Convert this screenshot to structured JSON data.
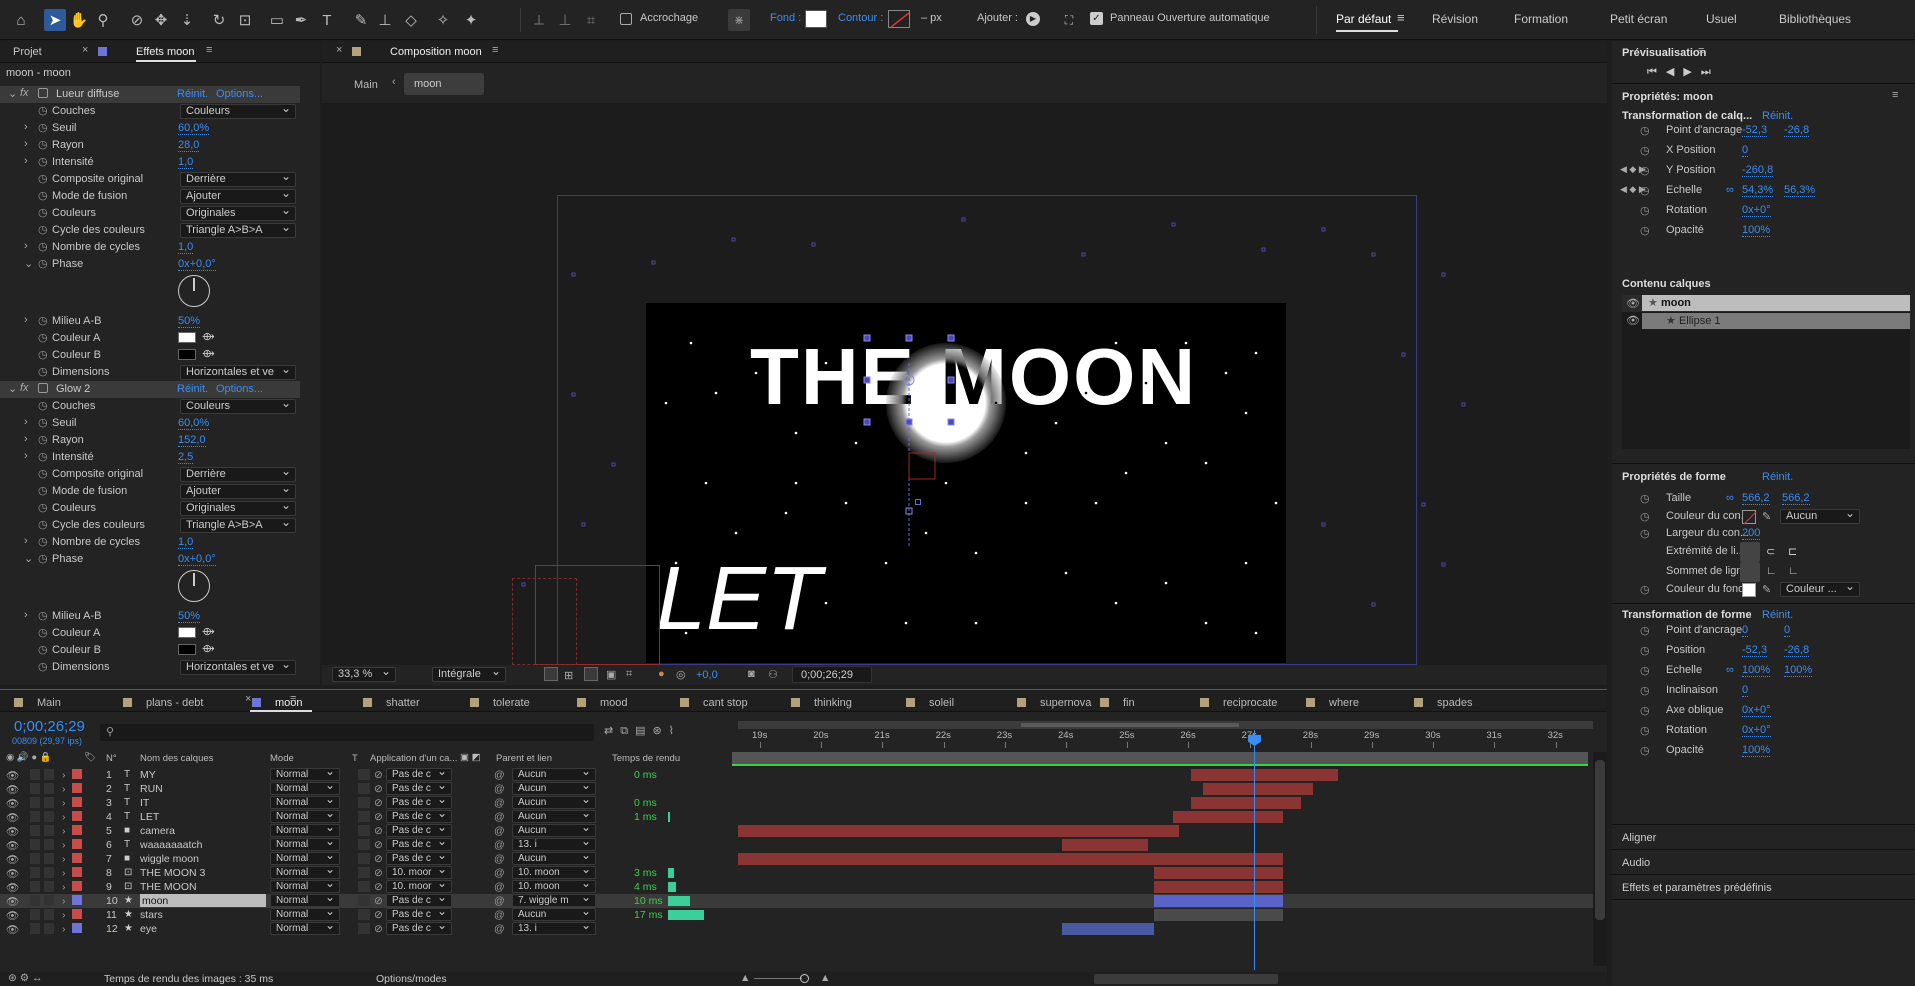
{
  "toolbar": {
    "snap_label": "Accrochage",
    "fill_label": "Fond :",
    "stroke_label": "Contour :",
    "px_label": "– px",
    "add_label": "Ajouter :",
    "auto_open_label": "Panneau Ouverture automatique"
  },
  "workspaces": [
    "Par défaut",
    "Révision",
    "Formation",
    "Petit écran",
    "Usuel",
    "Bibliothèques"
  ],
  "left_panel": {
    "tab_project": "Projet",
    "tab_effects": "Effets moon",
    "breadcrumb": "moon - moon",
    "effects": [
      {
        "name": "Lueur diffuse",
        "reset": "Réinit.",
        "options": "Options...",
        "props": [
          {
            "label": "Couches",
            "dd": "Couleurs"
          },
          {
            "label": "Seuil",
            "val": "60,0%"
          },
          {
            "label": "Rayon",
            "val": "28,0"
          },
          {
            "label": "Intensité",
            "val": "1,0"
          },
          {
            "label": "Composite original",
            "dd": "Derrière"
          },
          {
            "label": "Mode de fusion",
            "dd": "Ajouter"
          },
          {
            "label": "Couleurs",
            "dd": "Originales"
          },
          {
            "label": "Cycle des couleurs",
            "dd": "Triangle A>B>A"
          },
          {
            "label": "Nombre de cycles",
            "val": "1,0"
          },
          {
            "label": "Phase",
            "val": "0x+0,0°"
          },
          {
            "label": "Milieu A-B",
            "val": "50%"
          },
          {
            "label": "Couleur A"
          },
          {
            "label": "Couleur B"
          },
          {
            "label": "Dimensions",
            "dd": "Horizontales et ve"
          }
        ]
      },
      {
        "name": "Glow 2",
        "reset": "Réinit.",
        "options": "Options...",
        "props": [
          {
            "label": "Couches",
            "dd": "Couleurs"
          },
          {
            "label": "Seuil",
            "val": "60,0%"
          },
          {
            "label": "Rayon",
            "val": "152,0"
          },
          {
            "label": "Intensité",
            "val": "2,5"
          },
          {
            "label": "Composite original",
            "dd": "Derrière"
          },
          {
            "label": "Mode de fusion",
            "dd": "Ajouter"
          },
          {
            "label": "Couleurs",
            "dd": "Originales"
          },
          {
            "label": "Cycle des couleurs",
            "dd": "Triangle A>B>A"
          },
          {
            "label": "Nombre de cycles",
            "val": "1,0"
          },
          {
            "label": "Phase",
            "val": "0x+0,0°"
          },
          {
            "label": "Milieu A-B",
            "val": "50%"
          },
          {
            "label": "Couleur A"
          },
          {
            "label": "Couleur B"
          },
          {
            "label": "Dimensions",
            "dd": "Horizontales et ve"
          }
        ]
      }
    ]
  },
  "comp": {
    "tab": "Composition moon",
    "crumb_main": "Main",
    "crumb_moon": "moon",
    "title_text": "THE MOON",
    "let_text": "LET",
    "zoom": "33,3 %",
    "quality": "Intégrale",
    "exposure": "+0,0",
    "timecode": "0;00;26;29"
  },
  "timeline": {
    "tabs": [
      "Main",
      "plans - debt",
      "moon",
      "shatter",
      "tolerate",
      "mood",
      "cant stop",
      "thinking",
      "soleil",
      "supernova",
      "fin",
      "reciprocate",
      "where",
      "spades"
    ],
    "timecode": "0;00;26;29",
    "fps": "00809 (29,97 ips)",
    "headers": {
      "num": "N°",
      "name": "Nom des calques",
      "mode": "Mode",
      "t": "T",
      "app": "Application d'un ca...",
      "parent": "Parent et lien",
      "render": "Temps de rendu"
    },
    "ruler": [
      "19s",
      "20s",
      "21s",
      "22s",
      "23s",
      "24s",
      "25s",
      "26s",
      "27s",
      "28s",
      "29s",
      "30s",
      "31s",
      "32s"
    ],
    "layers": [
      {
        "n": "1",
        "name": "MY",
        "mode": "Normal",
        "app": "Pas de c",
        "parent": "Aucun",
        "render": "0 ms"
      },
      {
        "n": "2",
        "name": "RUN",
        "mode": "Normal",
        "app": "Pas de c",
        "parent": "Aucun",
        "render": ""
      },
      {
        "n": "3",
        "name": "IT",
        "mode": "Normal",
        "app": "Pas de c",
        "parent": "Aucun",
        "render": "0 ms"
      },
      {
        "n": "4",
        "name": "LET",
        "mode": "Normal",
        "app": "Pas de c",
        "parent": "Aucun",
        "render": "1 ms"
      },
      {
        "n": "5",
        "name": "camera",
        "mode": "Normal",
        "app": "Pas de c",
        "parent": "Aucun",
        "render": ""
      },
      {
        "n": "6",
        "name": "waaaaaaatch",
        "mode": "Normal",
        "app": "Pas de c",
        "parent": "13. i",
        "render": ""
      },
      {
        "n": "7",
        "name": "wiggle moon",
        "mode": "Normal",
        "app": "Pas de c",
        "parent": "Aucun",
        "render": ""
      },
      {
        "n": "8",
        "name": "THE MOON 3",
        "mode": "Normal",
        "app": "10. moor",
        "parent": "10. moon",
        "render": "3 ms"
      },
      {
        "n": "9",
        "name": "THE MOON",
        "mode": "Normal",
        "app": "10. moor",
        "parent": "10. moon",
        "render": "4 ms"
      },
      {
        "n": "10",
        "name": "moon",
        "mode": "Normal",
        "app": "Pas de c",
        "parent": "7. wiggle m",
        "render": "10 ms"
      },
      {
        "n": "11",
        "name": "stars",
        "mode": "Normal",
        "app": "Pas de c",
        "parent": "Aucun",
        "render": "17 ms"
      },
      {
        "n": "12",
        "name": "eye",
        "mode": "Normal",
        "app": "Pas de c",
        "parent": "13. i",
        "render": ""
      }
    ],
    "footer_render": "Temps de rendu des images : 35 ms",
    "footer_modes": "Options/modes"
  },
  "right_panel": {
    "preview": "Prévisualisation",
    "props_title": "Propriétés: moon",
    "layer_transform": "Transformation de calq...",
    "reset": "Réinit.",
    "transform": [
      {
        "label": "Point d'ancrage",
        "v1": "-52,3",
        "v2": "-26,8"
      },
      {
        "label": "X Position",
        "v1": "0",
        "v2": ""
      },
      {
        "label": "Y Position",
        "v1": "-260,8",
        "v2": ""
      },
      {
        "label": "Echelle",
        "v1": "54,3%",
        "v2": "56,3%"
      },
      {
        "label": "Rotation",
        "v1": "0x+0°",
        "v2": ""
      },
      {
        "label": "Opacité",
        "v1": "100%",
        "v2": ""
      }
    ],
    "content_title": "Contenu calques",
    "content_items": [
      "moon",
      "Ellipse 1"
    ],
    "shape_props": "Propriétés de forme",
    "size_label": "Taille",
    "size_v1": "566,2",
    "size_v2": "566,2",
    "stroke_color": "Couleur du con...",
    "stroke_none": "Aucun",
    "stroke_width": "Largeur du con...",
    "stroke_width_v": "200",
    "line_cap": "Extrémité de li...",
    "line_join": "Sommet de ligne",
    "fill_color": "Couleur du fond",
    "fill_type": "Couleur ...",
    "shape_transform": "Transformation de forme",
    "shape_tr": [
      {
        "label": "Point d'ancrage",
        "v1": "0",
        "v2": "0"
      },
      {
        "label": "Position",
        "v1": "-52,3",
        "v2": "-26,8"
      },
      {
        "label": "Echelle",
        "v1": "100%",
        "v2": "100%"
      },
      {
        "label": "Inclinaison",
        "v1": "0",
        "v2": ""
      },
      {
        "label": "Axe oblique",
        "v1": "0x+0°",
        "v2": ""
      },
      {
        "label": "Rotation",
        "v1": "0x+0°",
        "v2": ""
      },
      {
        "label": "Opacité",
        "v1": "100%",
        "v2": ""
      }
    ],
    "align": "Aligner",
    "audio": "Audio",
    "effects_presets": "Effets et paramètres prédéfinis"
  }
}
